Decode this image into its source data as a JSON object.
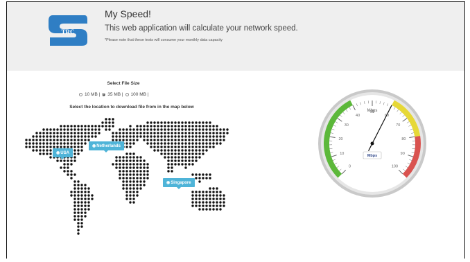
{
  "header": {
    "title": "My Speed!",
    "subtitle": "This web application will calculate your network speed.",
    "note": "*Please note that these tests will consume your monthly data capacity",
    "logo_text": "TRC"
  },
  "file_size": {
    "label": "Select File Size",
    "options": [
      {
        "label": "10 MB |",
        "selected": false
      },
      {
        "label": "35 MB |",
        "selected": true
      },
      {
        "label": "100 MB |",
        "selected": false
      }
    ]
  },
  "map": {
    "instruction": "Select the location to download file from in the map below",
    "locations": [
      {
        "label": "USA",
        "icon": "location-icon"
      },
      {
        "label": "Netherlands",
        "icon": "location-icon"
      },
      {
        "label": "Singapore",
        "icon": "location-icon"
      }
    ]
  },
  "gauge": {
    "unit_top": "Mbps",
    "unit_badge": "Mbps",
    "min": 0,
    "max": 100,
    "value": 60,
    "tick_labels": [
      "0",
      "10",
      "20",
      "30",
      "40",
      "50",
      "60",
      "70",
      "80",
      "90",
      "100"
    ],
    "colors": {
      "green": "#5cb83a",
      "yellow": "#e6d837",
      "red": "#d9534f"
    }
  }
}
